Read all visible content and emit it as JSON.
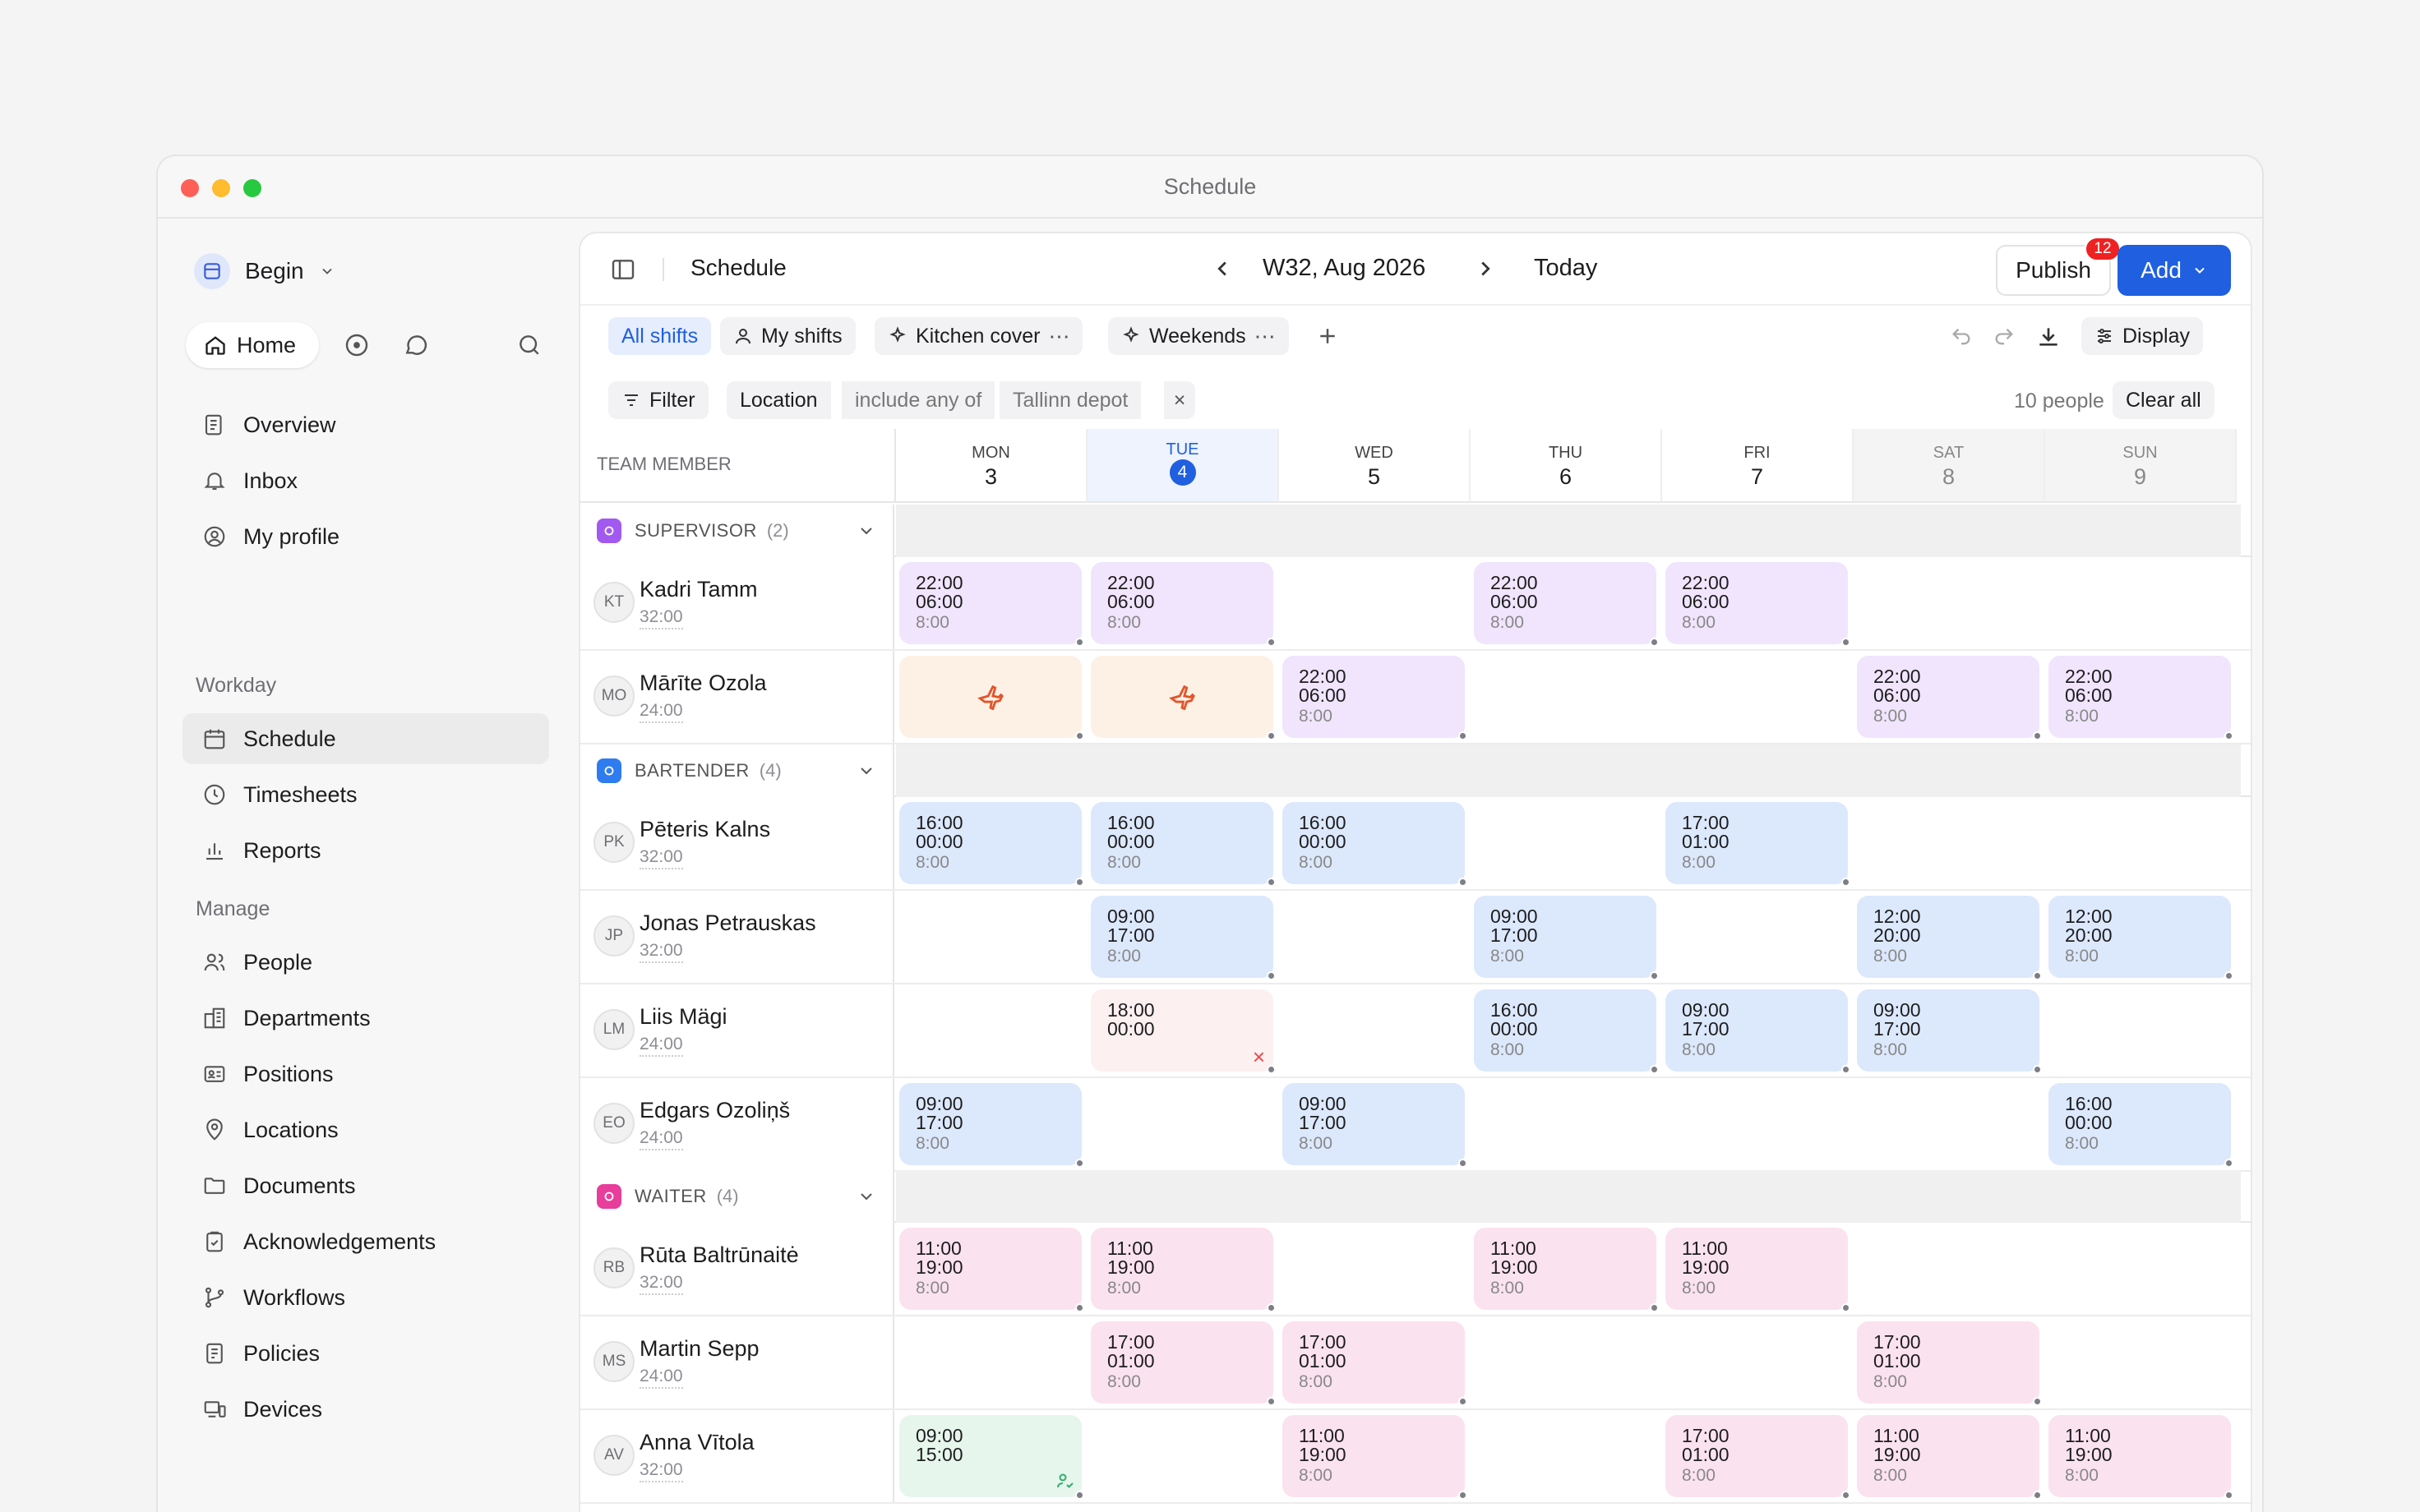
{
  "window": {
    "title": "Schedule"
  },
  "sidebar": {
    "workspace": "Begin",
    "home_label": "Home",
    "top_items": [
      {
        "label": "Overview",
        "icon": "overview-icon"
      },
      {
        "label": "Inbox",
        "icon": "bell-icon"
      },
      {
        "label": "My profile",
        "icon": "user-circle-icon"
      }
    ],
    "section_workday": "Workday",
    "workday_items": [
      {
        "label": "Schedule",
        "icon": "calendar-icon",
        "active": true
      },
      {
        "label": "Timesheets",
        "icon": "clock-icon"
      },
      {
        "label": "Reports",
        "icon": "bar-chart-icon"
      }
    ],
    "section_manage": "Manage",
    "manage_items": [
      {
        "label": "People",
        "icon": "people-icon"
      },
      {
        "label": "Departments",
        "icon": "building-icon"
      },
      {
        "label": "Positions",
        "icon": "id-card-icon"
      },
      {
        "label": "Locations",
        "icon": "map-pin-icon"
      },
      {
        "label": "Documents",
        "icon": "folder-icon"
      },
      {
        "label": "Acknowledgements",
        "icon": "clipboard-check-icon"
      },
      {
        "label": "Workflows",
        "icon": "branch-icon"
      },
      {
        "label": "Policies",
        "icon": "policy-icon"
      },
      {
        "label": "Devices",
        "icon": "devices-icon"
      }
    ]
  },
  "header": {
    "title": "Schedule",
    "week": "W32, Aug 2026",
    "today": "Today",
    "publish": "Publish",
    "publish_badge": "12",
    "add": "Add"
  },
  "tabs": [
    {
      "label": "All shifts",
      "active": true
    },
    {
      "label": "My shifts"
    },
    {
      "label": "Kitchen cover"
    },
    {
      "label": "Weekends"
    }
  ],
  "toolbar": {
    "display": "Display"
  },
  "filter": {
    "filter_label": "Filter",
    "field": "Location",
    "operator": "include any of",
    "value": "Tallinn depot",
    "count": "10 people",
    "clear": "Clear all"
  },
  "grid": {
    "member_header": "TEAM MEMBER",
    "days": [
      {
        "name": "MON",
        "date": "3"
      },
      {
        "name": "TUE",
        "date": "4",
        "today": true
      },
      {
        "name": "WED",
        "date": "5"
      },
      {
        "name": "THU",
        "date": "6"
      },
      {
        "name": "FRI",
        "date": "7"
      },
      {
        "name": "SAT",
        "date": "8",
        "weekend": true
      },
      {
        "name": "SUN",
        "date": "9",
        "weekend": true
      }
    ],
    "groups": [
      {
        "name": "SUPERVISOR",
        "count": "(2)",
        "color": "#a259f0",
        "people": [
          {
            "initials": "KT",
            "name": "Kadri Tamm",
            "hours": "32:00",
            "shifts": [
              {
                "day": 0,
                "type": "p",
                "start": "22:00",
                "end": "06:00",
                "dur": "8:00"
              },
              {
                "day": 1,
                "type": "p",
                "start": "22:00",
                "end": "06:00",
                "dur": "8:00"
              },
              {
                "day": 3,
                "type": "p",
                "start": "22:00",
                "end": "06:00",
                "dur": "8:00"
              },
              {
                "day": 4,
                "type": "p",
                "start": "22:00",
                "end": "06:00",
                "dur": "8:00"
              }
            ]
          },
          {
            "initials": "MO",
            "name": "Mārīte Ozola",
            "hours": "24:00",
            "shifts": [
              {
                "day": 0,
                "type": "o",
                "icon": "plane-icon"
              },
              {
                "day": 1,
                "type": "o",
                "icon": "plane-icon"
              },
              {
                "day": 2,
                "type": "p",
                "start": "22:00",
                "end": "06:00",
                "dur": "8:00"
              },
              {
                "day": 5,
                "type": "p",
                "start": "22:00",
                "end": "06:00",
                "dur": "8:00"
              },
              {
                "day": 6,
                "type": "p",
                "start": "22:00",
                "end": "06:00",
                "dur": "8:00"
              }
            ]
          }
        ]
      },
      {
        "name": "BARTENDER",
        "count": "(4)",
        "color": "#2f7bf0",
        "people": [
          {
            "initials": "PK",
            "name": "Pēteris Kalns",
            "hours": "32:00",
            "shifts": [
              {
                "day": 0,
                "type": "b",
                "start": "16:00",
                "end": "00:00",
                "dur": "8:00"
              },
              {
                "day": 1,
                "type": "b",
                "start": "16:00",
                "end": "00:00",
                "dur": "8:00"
              },
              {
                "day": 2,
                "type": "b",
                "start": "16:00",
                "end": "00:00",
                "dur": "8:00"
              },
              {
                "day": 4,
                "type": "b",
                "start": "17:00",
                "end": "01:00",
                "dur": "8:00"
              }
            ]
          },
          {
            "initials": "JP",
            "name": "Jonas Petrauskas",
            "hours": "32:00",
            "shifts": [
              {
                "day": 1,
                "type": "b",
                "start": "09:00",
                "end": "17:00",
                "dur": "8:00"
              },
              {
                "day": 3,
                "type": "b",
                "start": "09:00",
                "end": "17:00",
                "dur": "8:00"
              },
              {
                "day": 5,
                "type": "b",
                "start": "12:00",
                "end": "20:00",
                "dur": "8:00"
              },
              {
                "day": 6,
                "type": "b",
                "start": "12:00",
                "end": "20:00",
                "dur": "8:00"
              }
            ]
          },
          {
            "initials": "LM",
            "name": "Liis Mägi",
            "hours": "24:00",
            "shifts": [
              {
                "day": 1,
                "type": "r",
                "start": "18:00",
                "end": "00:00",
                "dur": "",
                "mark": "×"
              },
              {
                "day": 3,
                "type": "b",
                "start": "16:00",
                "end": "00:00",
                "dur": "8:00"
              },
              {
                "day": 4,
                "type": "b",
                "start": "09:00",
                "end": "17:00",
                "dur": "8:00"
              },
              {
                "day": 5,
                "type": "b",
                "start": "09:00",
                "end": "17:00",
                "dur": "8:00"
              }
            ]
          },
          {
            "initials": "EO",
            "name": "Edgars Ozoliņš",
            "hours": "24:00",
            "shifts": [
              {
                "day": 0,
                "type": "b",
                "start": "09:00",
                "end": "17:00",
                "dur": "8:00"
              },
              {
                "day": 2,
                "type": "b",
                "start": "09:00",
                "end": "17:00",
                "dur": "8:00"
              },
              {
                "day": 6,
                "type": "b",
                "start": "16:00",
                "end": "00:00",
                "dur": "8:00"
              }
            ]
          }
        ]
      },
      {
        "name": "WAITER",
        "count": "(4)",
        "color": "#e83d9a",
        "people": [
          {
            "initials": "RB",
            "name": "Rūta Baltrūnaitė",
            "hours": "32:00",
            "shifts": [
              {
                "day": 0,
                "type": "k",
                "start": "11:00",
                "end": "19:00",
                "dur": "8:00"
              },
              {
                "day": 1,
                "type": "k",
                "start": "11:00",
                "end": "19:00",
                "dur": "8:00"
              },
              {
                "day": 3,
                "type": "k",
                "start": "11:00",
                "end": "19:00",
                "dur": "8:00"
              },
              {
                "day": 4,
                "type": "k",
                "start": "11:00",
                "end": "19:00",
                "dur": "8:00"
              }
            ]
          },
          {
            "initials": "MS",
            "name": "Martin Sepp",
            "hours": "24:00",
            "shifts": [
              {
                "day": 1,
                "type": "k",
                "start": "17:00",
                "end": "01:00",
                "dur": "8:00"
              },
              {
                "day": 2,
                "type": "k",
                "start": "17:00",
                "end": "01:00",
                "dur": "8:00"
              },
              {
                "day": 5,
                "type": "k",
                "start": "17:00",
                "end": "01:00",
                "dur": "8:00"
              }
            ]
          },
          {
            "initials": "AV",
            "name": "Anna Vītola",
            "hours": "32:00",
            "shifts": [
              {
                "day": 0,
                "type": "g",
                "start": "09:00",
                "end": "15:00",
                "dur": "",
                "mark": "person-check"
              },
              {
                "day": 2,
                "type": "k",
                "start": "11:00",
                "end": "19:00",
                "dur": "8:00"
              },
              {
                "day": 4,
                "type": "k",
                "start": "17:00",
                "end": "01:00",
                "dur": "8:00"
              },
              {
                "day": 5,
                "type": "k",
                "start": "11:00",
                "end": "19:00",
                "dur": "8:00"
              },
              {
                "day": 6,
                "type": "k",
                "start": "11:00",
                "end": "19:00",
                "dur": "8:00"
              }
            ]
          }
        ]
      }
    ]
  }
}
